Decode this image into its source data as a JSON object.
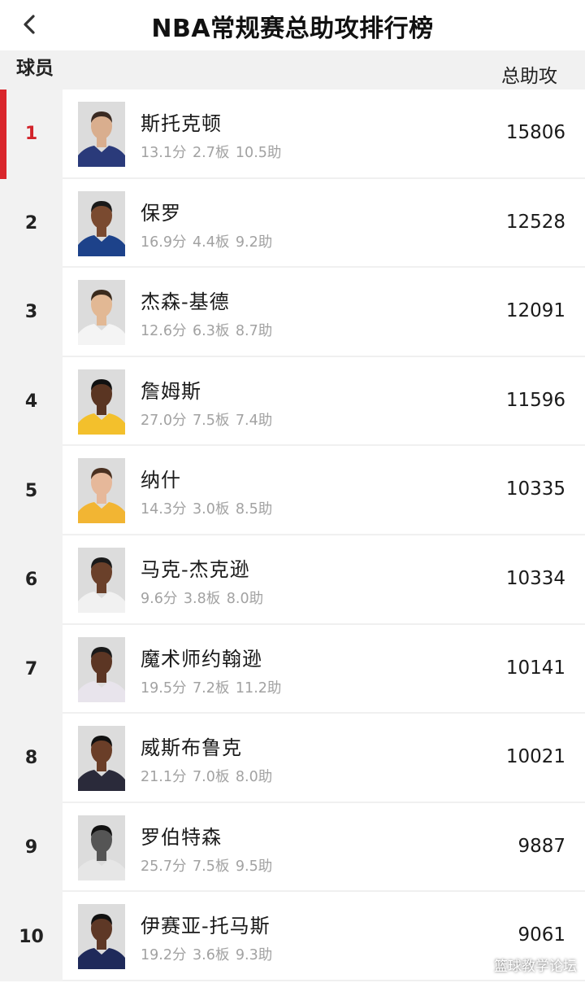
{
  "header": {
    "title": "NBA常规赛总助攻排行榜",
    "col_player": "球员",
    "col_assists": "总助攻"
  },
  "colors": {
    "accent": "#d9262c",
    "rank_highlight": "#d2232a",
    "stats_text": "#a2a2a2"
  },
  "icons": {
    "back": "chevron-left-icon"
  },
  "rows": [
    {
      "rank": "1",
      "name": "斯托克顿",
      "stats": "13.1分 2.7板 10.5助",
      "total": "15806",
      "jersey": "#2a3a7a",
      "skin": "#d9ae8e",
      "hair": "#3a2a22"
    },
    {
      "rank": "2",
      "name": "保罗",
      "stats": "16.9分 4.4板 9.2助",
      "total": "12528",
      "jersey": "#1d428a",
      "skin": "#7a4a30",
      "hair": "#1a1a1a"
    },
    {
      "rank": "3",
      "name": "杰森-基德",
      "stats": "12.6分 6.3板 8.7助",
      "total": "12091",
      "jersey": "#f4f4f4",
      "skin": "#e2b894",
      "hair": "#3a2a1c"
    },
    {
      "rank": "4",
      "name": "詹姆斯",
      "stats": "27.0分 7.5板 7.4助",
      "total": "11596",
      "jersey": "#f3c02c",
      "skin": "#5a3522",
      "hair": "#111111"
    },
    {
      "rank": "5",
      "name": "纳什",
      "stats": "14.3分 3.0板 8.5助",
      "total": "10335",
      "jersey": "#f2b533",
      "skin": "#e6b89a",
      "hair": "#4a3020"
    },
    {
      "rank": "6",
      "name": "马克-杰克逊",
      "stats": "9.6分 3.8板 8.0助",
      "total": "10334",
      "jersey": "#f1f1f1",
      "skin": "#6a402a",
      "hair": "#1a1a1a"
    },
    {
      "rank": "7",
      "name": "魔术师约翰逊",
      "stats": "19.5分 7.2板 11.2助",
      "total": "10141",
      "jersey": "#e8e4ec",
      "skin": "#5c3624",
      "hair": "#1a1a1a"
    },
    {
      "rank": "8",
      "name": "威斯布鲁克",
      "stats": "21.1分 7.0板 8.0助",
      "total": "10021",
      "jersey": "#2a2a3a",
      "skin": "#6a3e28",
      "hair": "#111111"
    },
    {
      "rank": "9",
      "name": "罗伯特森",
      "stats": "25.7分 7.5板 9.5助",
      "total": "9887",
      "jersey": "#e6e6e6",
      "skin": "#555555",
      "hair": "#111111"
    },
    {
      "rank": "10",
      "name": "伊赛亚-托马斯",
      "stats": "19.2分 3.6板 9.3助",
      "total": "9061",
      "jersey": "#1f2a5a",
      "skin": "#5e3826",
      "hair": "#111111"
    }
  ],
  "watermark": "篮球教学论坛"
}
